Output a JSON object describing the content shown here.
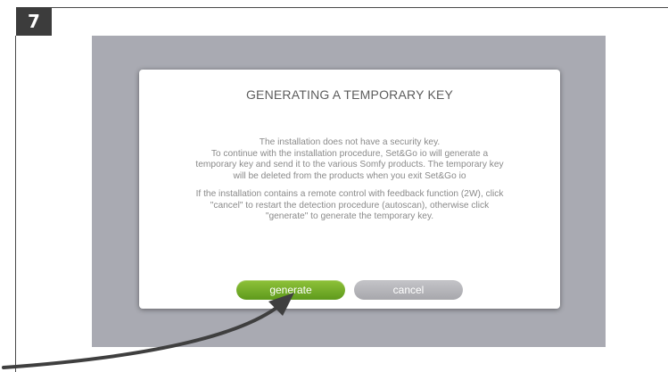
{
  "step": {
    "number": "7"
  },
  "dialog": {
    "title": "GENERATING A TEMPORARY KEY",
    "paragraph1": [
      "The installation does not have a security key.",
      "To continue with the installation procedure, Set&Go io will generate a",
      "temporary key and send it to the various Somfy products. The temporary key",
      "will be deleted from the products when you exit Set&Go io"
    ],
    "paragraph2": [
      "If the installation contains a remote control with feedback function (2W), click",
      "\"cancel\" to restart the detection procedure (autoscan), otherwise click",
      "\"generate\" to generate the temporary key."
    ],
    "generate_label": "generate",
    "cancel_label": "cancel"
  },
  "colors": {
    "screen_background": "#a9aab2",
    "generate_button": "#6ea82a",
    "cancel_button": "#b5b5ba",
    "arrow": "#3f3f3f",
    "step_badge": "#3c3c3c"
  },
  "icons": {
    "pointer": "curved-arrow-icon"
  }
}
